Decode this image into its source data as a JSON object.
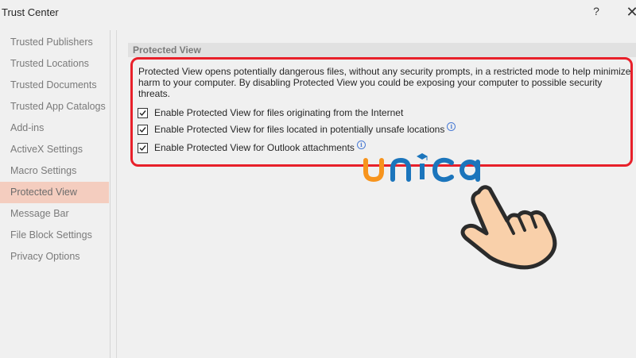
{
  "window": {
    "title": "Trust Center",
    "help_glyph": "?",
    "close_glyph": "✕"
  },
  "sidebar": {
    "items": [
      {
        "label": "Trusted Publishers"
      },
      {
        "label": "Trusted Locations"
      },
      {
        "label": "Trusted Documents"
      },
      {
        "label": "Trusted App Catalogs"
      },
      {
        "label": "Add-ins"
      },
      {
        "label": "ActiveX Settings"
      },
      {
        "label": "Macro Settings"
      },
      {
        "label": "Protected View",
        "selected": true
      },
      {
        "label": "Message Bar"
      },
      {
        "label": "File Block Settings"
      },
      {
        "label": "Privacy Options"
      }
    ]
  },
  "main": {
    "section_title": "Protected View",
    "description": "Protected View opens potentially dangerous files, without any security prompts, in a restricted mode to help minimize harm to your computer. By disabling Protected View you could be exposing your computer to possible security threats.",
    "options": [
      {
        "label": "Enable Protected View for files originating from the Internet",
        "checked": true,
        "info": false
      },
      {
        "label": "Enable Protected View for files located in potentially unsafe locations",
        "checked": true,
        "info": true
      },
      {
        "label": "Enable Protected View for Outlook attachments",
        "checked": true,
        "info": true
      }
    ]
  },
  "overlay": {
    "logo_text": "unica",
    "highlight_color": "#e8202a",
    "logo_orange": "#f7941d",
    "logo_blue": "#1b75bc",
    "hand_icon": "pointing-hand-icon"
  }
}
